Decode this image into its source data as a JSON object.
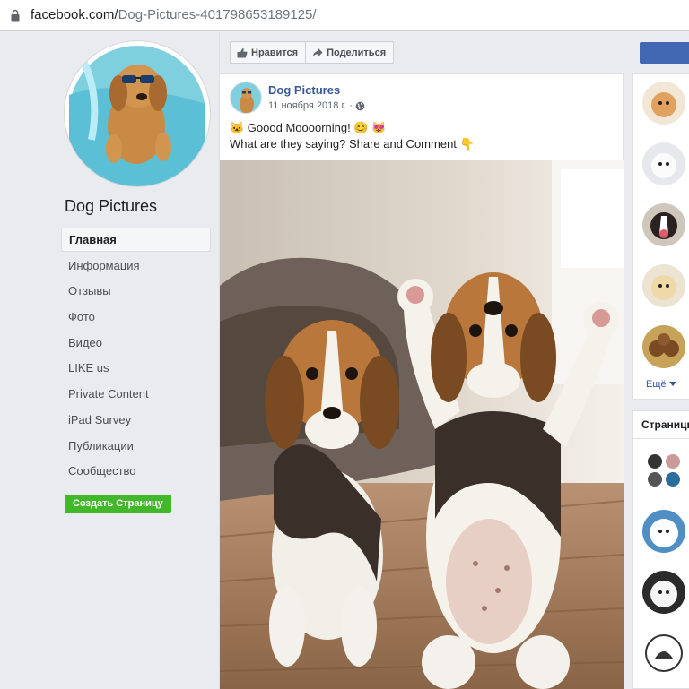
{
  "browser": {
    "url_domain": "facebook.com/",
    "url_path": "Dog-Pictures-401798653189125/"
  },
  "page": {
    "name": "Dog Pictures"
  },
  "nav": {
    "items": [
      {
        "label": "Главная",
        "active": true
      },
      {
        "label": "Информация"
      },
      {
        "label": "Отзывы"
      },
      {
        "label": "Фото"
      },
      {
        "label": "Видео"
      },
      {
        "label": "LIKE us"
      },
      {
        "label": "Private Content"
      },
      {
        "label": "iPad Survey"
      },
      {
        "label": "Публикации"
      },
      {
        "label": "Сообщество"
      }
    ],
    "create_page_label": "Создать Страницу"
  },
  "actions": {
    "like_label": "Нравится",
    "share_label": "Поделиться"
  },
  "post": {
    "author": "Dog Pictures",
    "date": "11 ноября 2018 г.",
    "separator": "·",
    "line1": "🐱 Goood Moooorning! 😊 😻",
    "line2": "What are they saying? Share and Comment 👇"
  },
  "sidebar": {
    "more_label": "Ещё",
    "pages_title": "Страницы"
  },
  "colors": {
    "brand_blue": "#4267b2",
    "link_blue": "#385898",
    "create_green": "#42b72a"
  }
}
